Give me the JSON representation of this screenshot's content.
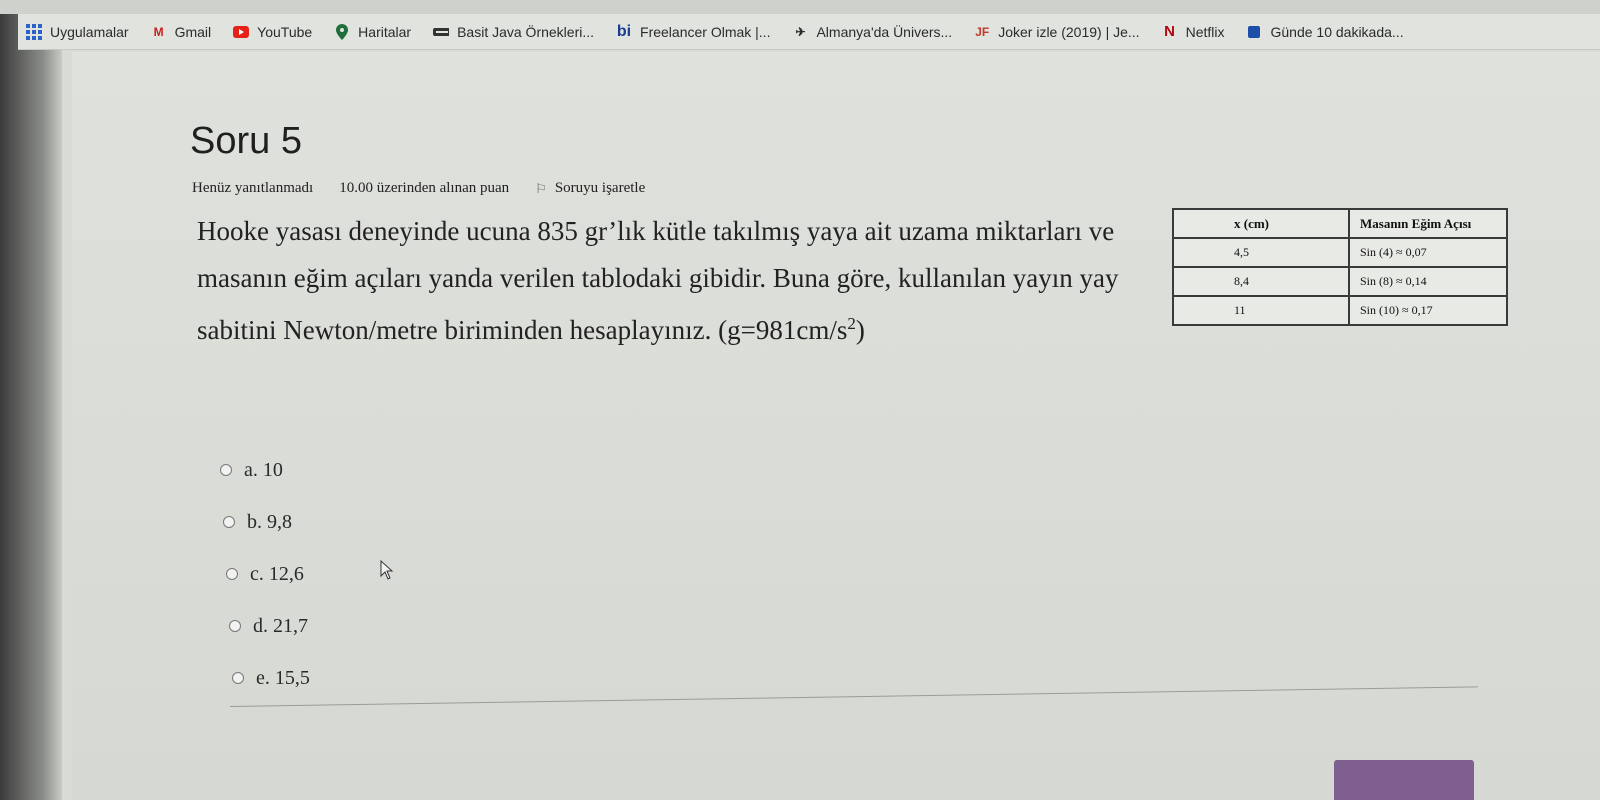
{
  "bookmarks": [
    {
      "label": "Uygulamalar",
      "icon": "apps-grid-icon"
    },
    {
      "label": "Gmail",
      "icon": "gmail-icon"
    },
    {
      "label": "YouTube",
      "icon": "youtube-icon"
    },
    {
      "label": "Haritalar",
      "icon": "maps-pin-icon"
    },
    {
      "label": "Basit Java Örnekleri...",
      "icon": "java-icon"
    },
    {
      "label": "Freelancer Olmak |...",
      "icon": "bi-icon"
    },
    {
      "label": "Almanya'da Ünivers...",
      "icon": "plane-icon"
    },
    {
      "label": "Joker izle (2019) | Je...",
      "icon": "jf-icon"
    },
    {
      "label": "Netflix",
      "icon": "netflix-icon"
    },
    {
      "label": "Günde 10 dakikada...",
      "icon": "bookmark-icon"
    }
  ],
  "question": {
    "title": "Soru 5",
    "status": "Henüz yanıtlanmadı",
    "points": "10.00 üzerinden alınan puan",
    "flag_label": "Soruyu işaretle",
    "text_main": "Hooke yasası deneyinde ucuna 835 gr’lık kütle takılmış yaya ait uzama miktarları ve masanın eğim açıları yanda verilen tablodaki gibidir. Buna göre, kullanılan yayın yay sabitini Newton/metre biriminden hesaplayınız. (g=981cm/s",
    "text_sup": "2",
    "text_end": ")"
  },
  "table": {
    "headers": [
      "x (cm)",
      "Masanın Eğim Açısı"
    ],
    "rows": [
      [
        "4,5",
        "Sin (4) ≈ 0,07"
      ],
      [
        "8,4",
        "Sin (8) ≈ 0,14"
      ],
      [
        "11",
        "Sin (10) ≈ 0,17"
      ]
    ]
  },
  "options": [
    {
      "label": "a. 10"
    },
    {
      "label": "b. 9,8"
    },
    {
      "label": "c. 12,6"
    },
    {
      "label": "d. 21,7"
    },
    {
      "label": "e. 15,5"
    }
  ]
}
